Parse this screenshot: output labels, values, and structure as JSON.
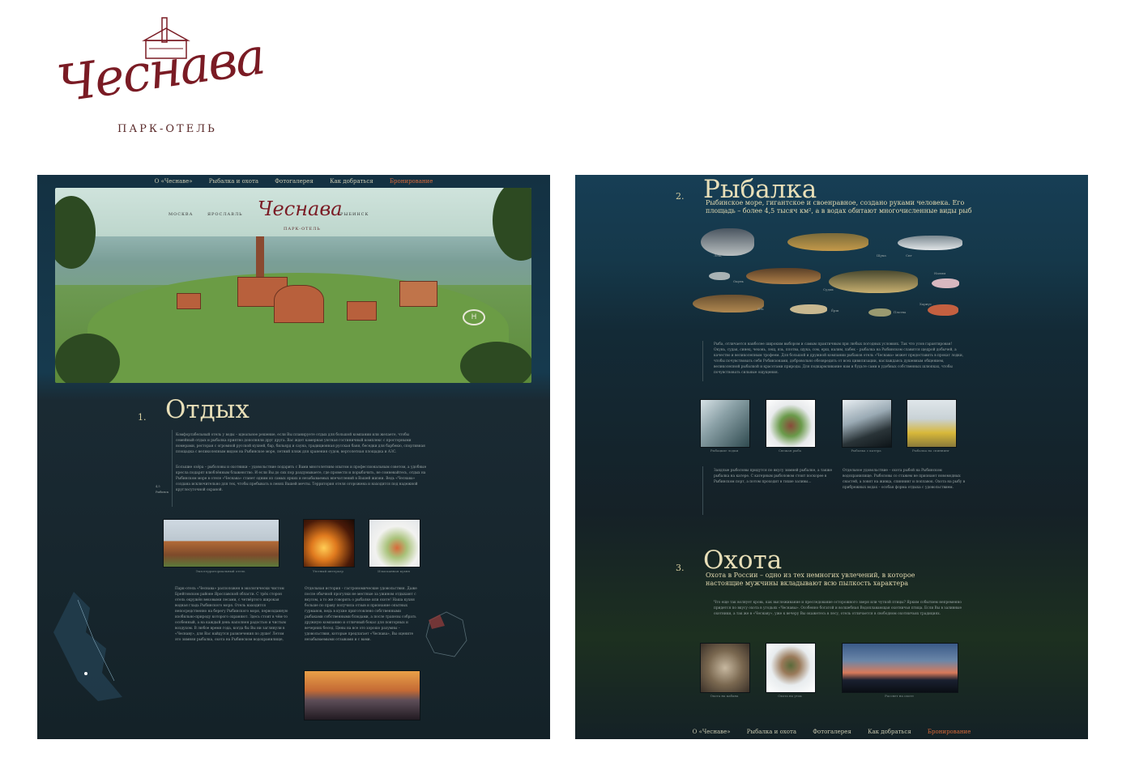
{
  "logo": {
    "script_text": "Чеснава",
    "subtitle": "ПАРК-ОТЕЛЬ"
  },
  "nav": {
    "items": [
      "О «Чеснаве»",
      "Рыбалка и охота",
      "Фотогалерея",
      "Как добраться",
      "Бронирование"
    ],
    "active_index": 4,
    "active_color": "#d96a3a"
  },
  "hero": {
    "brand": "Чеснава",
    "brand_sub": "ПАРК-ОТЕЛЬ",
    "city_left_1": "МОСКВА",
    "city_left_2": "ЯРОСЛАВЛЬ",
    "city_right": "РЫБИНСК",
    "helipad": "H"
  },
  "sections": {
    "rest": {
      "number": "1.",
      "title": "Отдых",
      "side_note": "4,5 Рыбинск",
      "para1": "Комфортабельный отель у воды – идеальное решение, если Вы планируете отдых для большой компании или желаете, чтобы семейный отдых и рыбалка приятно дополняли друг друга. Вас ждет камерная уютная гостиничный комплекс с просторными номерами, ресторан с огромной русской кухней, бар, бильярд и сауна, традиционная русская баня, беседки для барбекю, спортивная площадка с великолепным видом на Рыбинское море, летний пляж для хранения судов, вертолетная площадка и АЗС.",
      "para2": "Большие озёра – рыболовы и охотники – удовольствие подарить с Вами многолетним опытом и профессиональным советом, а удобные кресла подарят влюблённым блаженство. И если Вы до сих пор раздумываете, где провести и порыбачить, не сомневайтесь, отдых на Рыбинском море в отеле «Чеснава» станет одним из самых ярких и незабываемых впечатлений в Вашей жизни. Ведь «Чеснава» создана исключительно для тех, чтобы пребывать в ленях Вашей мечты. Территория отеля огорожена и находится под надежной круглосуточной охраной.",
      "photos": [
        "Экзотерриториальный отель",
        "Уютный интерьер",
        "Изысканная кухня"
      ],
      "col1": "Парк-отель «Чеснава» расположен в экологически чистом Брейтовском районе Ярославской области. С трёх сторон отель окружён вековыми лесами, с четвёртого широкая водная гладь Рыбинского моря. Отель находится непосредственно на берегу Рыбинского моря, первозданную изобильно-природу которого охраняют. Здесь стоит в чём-то особенный, а на каждый день наполнен радостью и чистым воздухом. В любое время года, когда бы Вы ни заглянули в «Чеснаву», для Вас найдутся развлечения по душе! Летом это зимняя рыбалка, охота на Рыбинском водохранилище, катание на снегоходах, зимние игры на свежем воздухе, настоящие променады по лесным тропинкам с всего и не перечислить.",
      "col2": "Отдельная история – гастрономические удовольствия. Даже после обычной прогулки не местные за ужином отдыхают с вкусом, а то же говорить о рыбалке или охоте! Наша кухня больше по праву получила отзыв и признание опытных гурманов, ведь в кухне приготовлено собственными рыбаками собственными блюдами, а после трапезы собрать дружную компанию и отличный бокал для повторных и вечерних бесед. Цены на все это хорошо разумны – удовольствия, которые предлагает «Чеснава», Вы оцените незабываемыми отзывами и с вами."
    },
    "fishing": {
      "number": "2.",
      "title": "Рыбалка",
      "subtitle": "Рыбинское море, гигантское и своенравное, создано руками человека. Его площадь – более 4,5 тысяч км², а в водах обитают многочисленные виды рыб",
      "fish_labels": [
        "Лещ",
        "Щука",
        "Сиг",
        "Окунь",
        "Судак",
        "Налим",
        "Язь",
        "Ёрш",
        "Плотва",
        "Хариус",
        "Форель"
      ],
      "para": "Рыба, отличается наиболее широким выбором и самым практичным при любых погодных условиях. Так что улов гарантирован! Окунь, судак, синец, чехонь, лещ, язь, плотва, щука, сом, ерш, налим, лабек – рыбалка на Рыбинском славится щедрой добычей, а качество и великолепным трофеем. Для большой и дружной компании рыбаков отель «Чеснава» может предоставить в прокат лодки, чтобы почувствовать себя Робинзонами, добровольно обезвредить от всех цивилизации, наслаждаясь душевным общением, великолепной рыбалкой и красотами природы. Для подкармливание нам и будьте сами в удобных собственных шлюпках, чтобы почувствовать сильные ощущения.",
      "photos": [
        "Рыбацкие лодки",
        "Свежая рыба",
        "Рыбалка с катера",
        "Рыбалка на спиннинг"
      ],
      "col1": "Заядлые рыболовы придутся по вкусу зимней рыбалке, а также рыбалка на катере. С катерным рыболовом стоит поскорее в Рыбинском порт, а потом проходит в тихие заливы...",
      "col2": "Отдельное удовольствие – охота рыбой на Рыбинском водохранилище. Рыболовы со стажем не признают новомодных снастей, а ловят на живца, спиннинг и поплавок. Охота на рыбу в прибрежных водах – особая форма отдыха с удовольствием."
    },
    "hunting": {
      "number": "3.",
      "title": "Охота",
      "subtitle": "Охота в России – одно из тех немногих увлечений, в которое настоящие мужчины вкладывают всю пылкость характера",
      "para": "Что еще так волнует кровь, как выслеживание и преследование осторожного зверя или чуткой птицы? Ярким событием непременно придется по вкусу охота в угодьях «Чеснавы». Особенно богатой и волшебная Водоплавающая охотничья птица. Если Вы в заливные охотники, а так же в «Чеснаву», уже к вечеру Вы окажетесь в лесу, отель отличается в свободном охотничьих традициях.",
      "photos": [
        "Охота на кабана",
        "Охота на уток",
        "Рассвет на охоте"
      ]
    }
  },
  "colors": {
    "heading": "#e8dfb8",
    "body_text": "#98a3a3",
    "logo_red": "#7a1b24"
  }
}
